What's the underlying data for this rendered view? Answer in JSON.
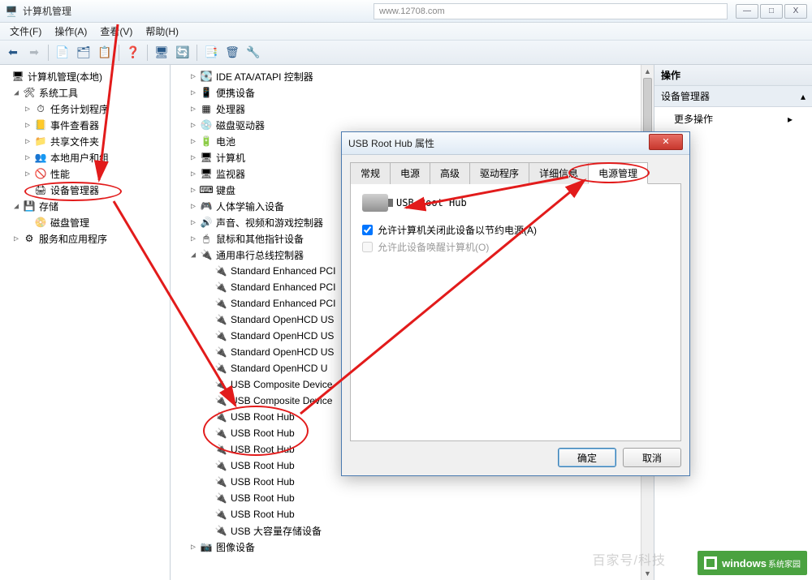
{
  "window": {
    "title": "计算机管理",
    "address": "www.12708.com",
    "btns": {
      "min": "—",
      "max": "□",
      "close": "X"
    }
  },
  "menu": [
    "文件(F)",
    "操作(A)",
    "查看(V)",
    "帮助(H)"
  ],
  "left_tree": {
    "root": "计算机管理(本地)",
    "sys_tools": "系统工具",
    "sys_children": [
      "任务计划程序",
      "事件查看器",
      "共享文件夹",
      "本地用户和组",
      "性能",
      "设备管理器"
    ],
    "storage": "存储",
    "storage_children": [
      "磁盘管理"
    ],
    "services": "服务和应用程序"
  },
  "mid_tree": {
    "items_top": [
      "IDE ATA/ATAPI 控制器",
      "便携设备",
      "处理器",
      "磁盘驱动器",
      "电池",
      "计算机",
      "监视器",
      "键盘",
      "人体学输入设备",
      "声音、视频和游戏控制器",
      "鼠标和其他指针设备"
    ],
    "usb_ctrl": "通用串行总线控制器",
    "usb_children": [
      "Standard Enhanced PCI",
      "Standard Enhanced PCI",
      "Standard Enhanced PCI",
      "Standard OpenHCD US",
      "Standard OpenHCD US",
      "Standard OpenHCD US",
      "Standard OpenHCD U",
      "USB Composite Device",
      "USB Composite Device",
      "USB Root Hub",
      "USB Root Hub",
      "USB Root Hub",
      "USB Root Hub",
      "USB Root Hub",
      "USB Root Hub",
      "USB Root Hub",
      "USB 大容量存储设备"
    ],
    "imaging": "图像设备"
  },
  "right_pane": {
    "header": "操作",
    "section": "设备管理器",
    "more": "更多操作"
  },
  "dialog": {
    "title": "USB Root Hub 属性",
    "tabs": [
      "常规",
      "电源",
      "高级",
      "驱动程序",
      "详细信息",
      "电源管理"
    ],
    "device_label": "USB Root Hub",
    "chk1": "允许计算机关闭此设备以节约电源(A)",
    "chk2": "允许此设备唤醒计算机(O)",
    "ok": "确定",
    "cancel": "取消"
  },
  "watermark": "百家号/科技",
  "logo": {
    "brand": "windows",
    "sub": "系统家园"
  }
}
